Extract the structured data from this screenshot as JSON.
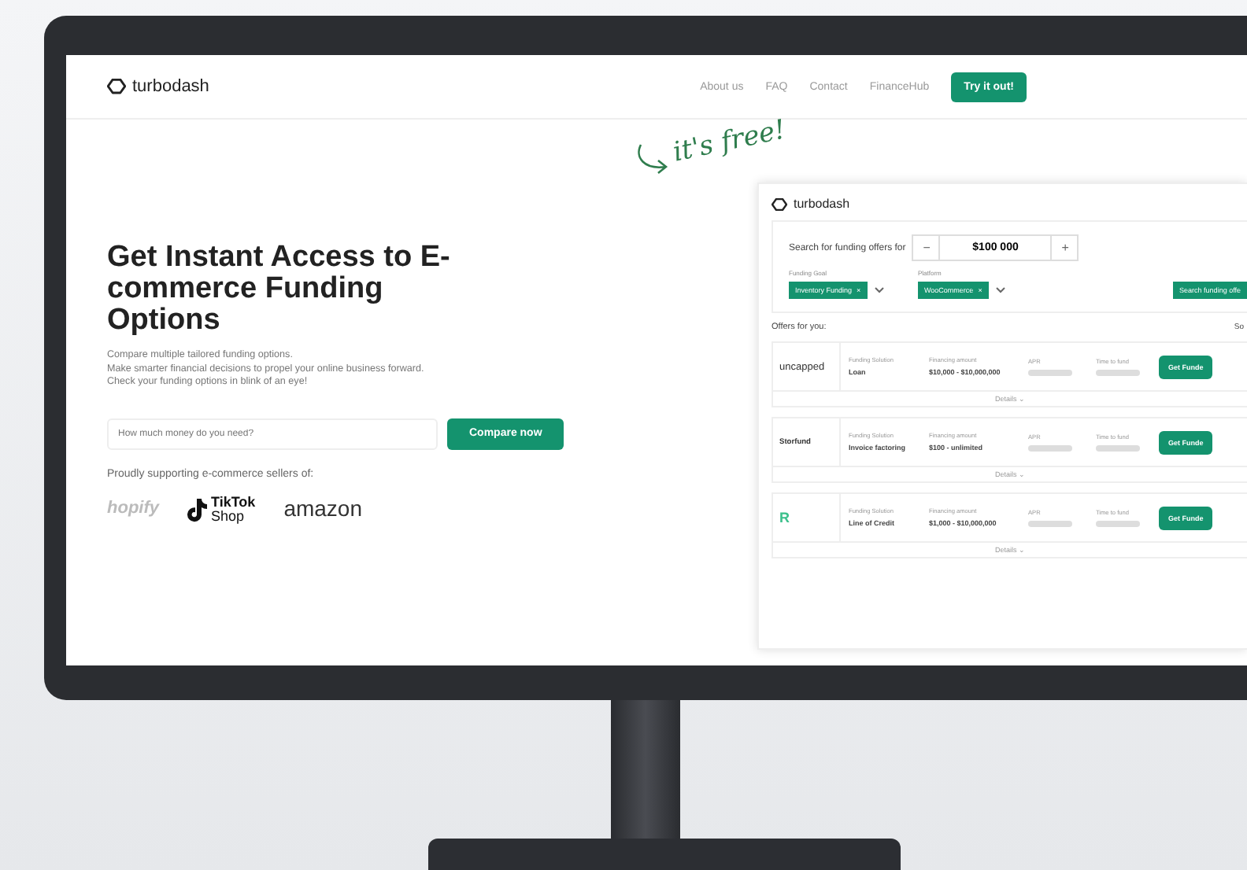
{
  "nav": {
    "brand": "turbodash",
    "links": [
      "About us",
      "FAQ",
      "Contact",
      "FinanceHub"
    ],
    "cta": "Try it out!"
  },
  "hero": {
    "title": "Get Instant Access to E-commerce Funding Options",
    "lines": [
      "Compare multiple tailored funding options.",
      "Make smarter financial decisions to propel your online business forward.",
      "Check your funding options in blink of an eye!"
    ],
    "input": {
      "placeholder": "How much money do you need?"
    },
    "button": "Compare now",
    "supporting": "Proudly supporting e-commerce sellers of:",
    "logos": [
      {
        "kind": "shopify",
        "text": "hopify"
      },
      {
        "kind": "tiktok",
        "text": "TikTok",
        "sub": "Shop"
      },
      {
        "kind": "amazon",
        "text": "amazon"
      }
    ]
  },
  "annotation": "it's free!",
  "panel": {
    "brand": "turbodash",
    "search_label": "Search for funding offers for",
    "minus": "−",
    "amount": "$100 000",
    "plus": "+",
    "filters": [
      {
        "label": "Funding Goal",
        "chip": "Inventory Funding",
        "remove": "×"
      },
      {
        "label": "Platform",
        "chip": "WooCommerce",
        "remove": "×"
      }
    ],
    "search_button": "Search funding offe",
    "offers_title": "Offers for you:",
    "sort": "So",
    "offers": [
      {
        "kind": "uncapped",
        "lender": "uncapped",
        "labels": [
          "Funding Solution",
          "Financing amount",
          "APR",
          "Time to fund"
        ],
        "solution": "Loan",
        "amount": "$10,000 - $10,000,000",
        "cta": "Get Funde",
        "details": "Details ⌄"
      },
      {
        "kind": "storfund",
        "lender": "Storfund",
        "labels": [
          "Funding Solution",
          "Financing amount",
          "APR",
          "Time to fund"
        ],
        "solution": "Invoice factoring",
        "amount": "$100 - unlimited",
        "cta": "Get Funde",
        "details": "Details ⌄"
      },
      {
        "kind": "kapital",
        "lender": "R",
        "labels": [
          "Funding Solution",
          "Financing amount",
          "APR",
          "Time to fund"
        ],
        "solution": "Line of Credit",
        "amount": "$1,000 - $10,000,000",
        "cta": "Get Funde",
        "details": "Details ⌄"
      }
    ]
  }
}
